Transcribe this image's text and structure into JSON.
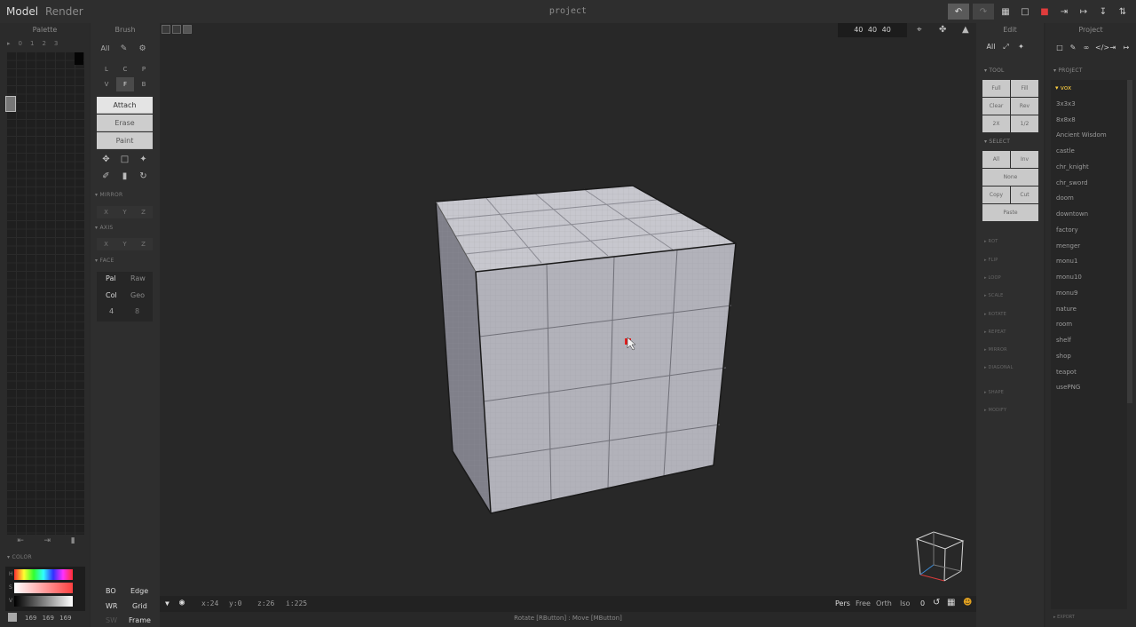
{
  "topbar": {
    "mode_model": "Model",
    "mode_render": "Render",
    "title": "project"
  },
  "palette": {
    "header": "Palette",
    "columns": [
      "▸",
      "0",
      "1",
      "2",
      "3"
    ],
    "color_label": "▾ COLOR",
    "hsv": [
      "H",
      "S",
      "V"
    ],
    "rgb": "169 169 169",
    "rgb_color": "#a9a9a9"
  },
  "brush": {
    "header": "Brush",
    "all": "All",
    "lcp": [
      "L",
      "C",
      "P",
      "V",
      "F",
      "B"
    ],
    "modes": [
      "Attach",
      "Erase",
      "Paint"
    ],
    "mirror_label": "▾ MIRROR",
    "axis_label": "▾ AXIS",
    "face_label": "▾ FACE",
    "axes": [
      "X",
      "Y",
      "Z"
    ],
    "face": {
      "pal": "Pal",
      "raw": "Raw",
      "col": "Col",
      "geo": "Geo",
      "n1": "4",
      "n2": "8"
    },
    "bottom": {
      "bo": "BO",
      "edge": "Edge",
      "wr": "WR",
      "grid": "Grid",
      "sw": "SW",
      "frame": "Frame"
    }
  },
  "viewport": {
    "dims": "40 40 40",
    "coords": {
      "x": "x:24",
      "y": "y:0",
      "z": "z:26",
      "i": "i:225"
    },
    "views": [
      "Pers",
      "Free",
      "Orth",
      "Iso"
    ],
    "zero": "0",
    "hint": "Rotate [RButton] : Move [MButton]"
  },
  "edit": {
    "header": "Edit",
    "all": "All",
    "tool_label": "▾ TOOL",
    "tool_buttons": [
      "Full",
      "Fill",
      "Clear",
      "Rev",
      "2X",
      "1/2"
    ],
    "select_label": "▾ SELECT",
    "select_buttons": [
      "All",
      "Inv",
      "None",
      "Copy",
      "Cut",
      "Paste"
    ],
    "sub_sections": [
      "▸ ROT",
      "▸ FLIP",
      "▸ LOOP",
      "▸ SCALE",
      "▸ ROTATE",
      "▸ REPEAT",
      "▸ MIRROR",
      "▸ DIAGONAL",
      "▸ SHAPE",
      "▸ MODIFY"
    ]
  },
  "project": {
    "header": "Project",
    "section_label": "▾ PROJECT",
    "files": [
      "▾ vox",
      "3x3x3",
      "8x8x8",
      "Ancient Wisdom",
      "castle",
      "chr_knight",
      "chr_sword",
      "doom",
      "downtown",
      "factory",
      "menger",
      "monu1",
      "monu10",
      "monu9",
      "nature",
      "room",
      "shelf",
      "shop",
      "teapot",
      "usePNG"
    ],
    "export_label": "▸ EXPORT"
  }
}
